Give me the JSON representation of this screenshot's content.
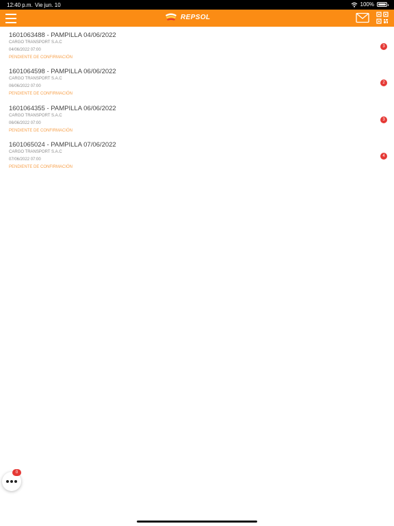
{
  "status_bar": {
    "time": "12:40 p.m.",
    "date": "Vie jun. 10",
    "battery": "100%",
    "wifi_icon": "wifi-icon",
    "battery_icon": "battery-icon"
  },
  "header": {
    "brand": "REPSOL",
    "menu_icon": "hamburger-menu-icon",
    "mail_icon": "envelope-icon",
    "qr_icon": "qr-code-icon",
    "background_color": "#fb8c14"
  },
  "orders": [
    {
      "title": "1601063488 - PAMPILLA 04/06/2022",
      "company": "CARGO TRANSPORT S.A.C",
      "datetime": "04/06/2022 07:00",
      "status": "PENDIENTE DE CONFIRMACIÓN",
      "count": "3"
    },
    {
      "title": "1601064598 - PAMPILLA 06/06/2022",
      "company": "CARGO TRANSPORT S.A.C",
      "datetime": "06/06/2022 07:00",
      "status": "PENDIENTE DE CONFIRMACIÓN",
      "count": "2"
    },
    {
      "title": "1601064355 - PAMPILLA 06/06/2022",
      "company": "CARGO TRANSPORT S.A.C",
      "datetime": "06/06/2022 07:00",
      "status": "PENDIENTE DE CONFIRMACIÓN",
      "count": "3"
    },
    {
      "title": "1601065024 - PAMPILLA 07/06/2022",
      "company": "CARGO TRANSPORT S.A.C",
      "datetime": "07/06/2022 07:00",
      "status": "PENDIENTE DE CONFIRMACIÓN",
      "count": "4"
    }
  ],
  "fab": {
    "badge": "0",
    "icon": "more-dots-icon"
  },
  "colors": {
    "accent": "#fb8c14",
    "status_text": "#f7a04a",
    "badge": "#e53935"
  }
}
